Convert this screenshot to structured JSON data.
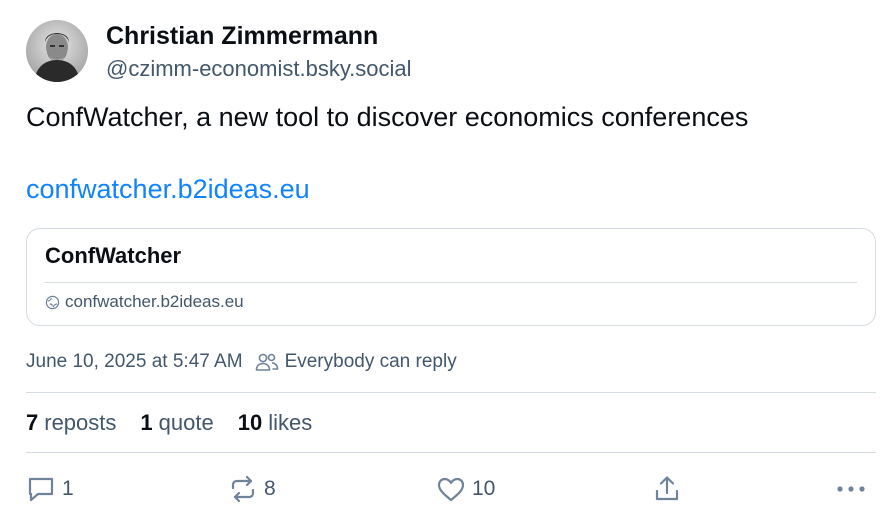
{
  "author": {
    "name": "Christian Zimmermann",
    "handle": "@czimm-economist.bsky.social"
  },
  "post": {
    "text": "ConfWatcher, a new tool to discover economics conferences",
    "link": "confwatcher.b2ideas.eu"
  },
  "embed": {
    "title": "ConfWatcher",
    "domain": "confwatcher.b2ideas.eu",
    "icon": "globe-icon"
  },
  "meta": {
    "timestamp": "June 10, 2025 at 5:47 AM",
    "reply_setting": "Everybody can reply",
    "reply_icon": "people-icon"
  },
  "stats": {
    "reposts_count": "7",
    "reposts_label": "reposts",
    "quotes_count": "1",
    "quotes_label": "quote",
    "likes_count": "10",
    "likes_label": "likes"
  },
  "actions": {
    "reply_count": "1",
    "repost_count": "8",
    "like_count": "10",
    "icons": [
      "reply-icon",
      "repost-icon",
      "like-icon",
      "share-icon",
      "more-icon"
    ]
  },
  "colors": {
    "text": "#0b0f14",
    "muted": "#42576c",
    "link": "#1083fe",
    "border": "#d4dbe2"
  }
}
